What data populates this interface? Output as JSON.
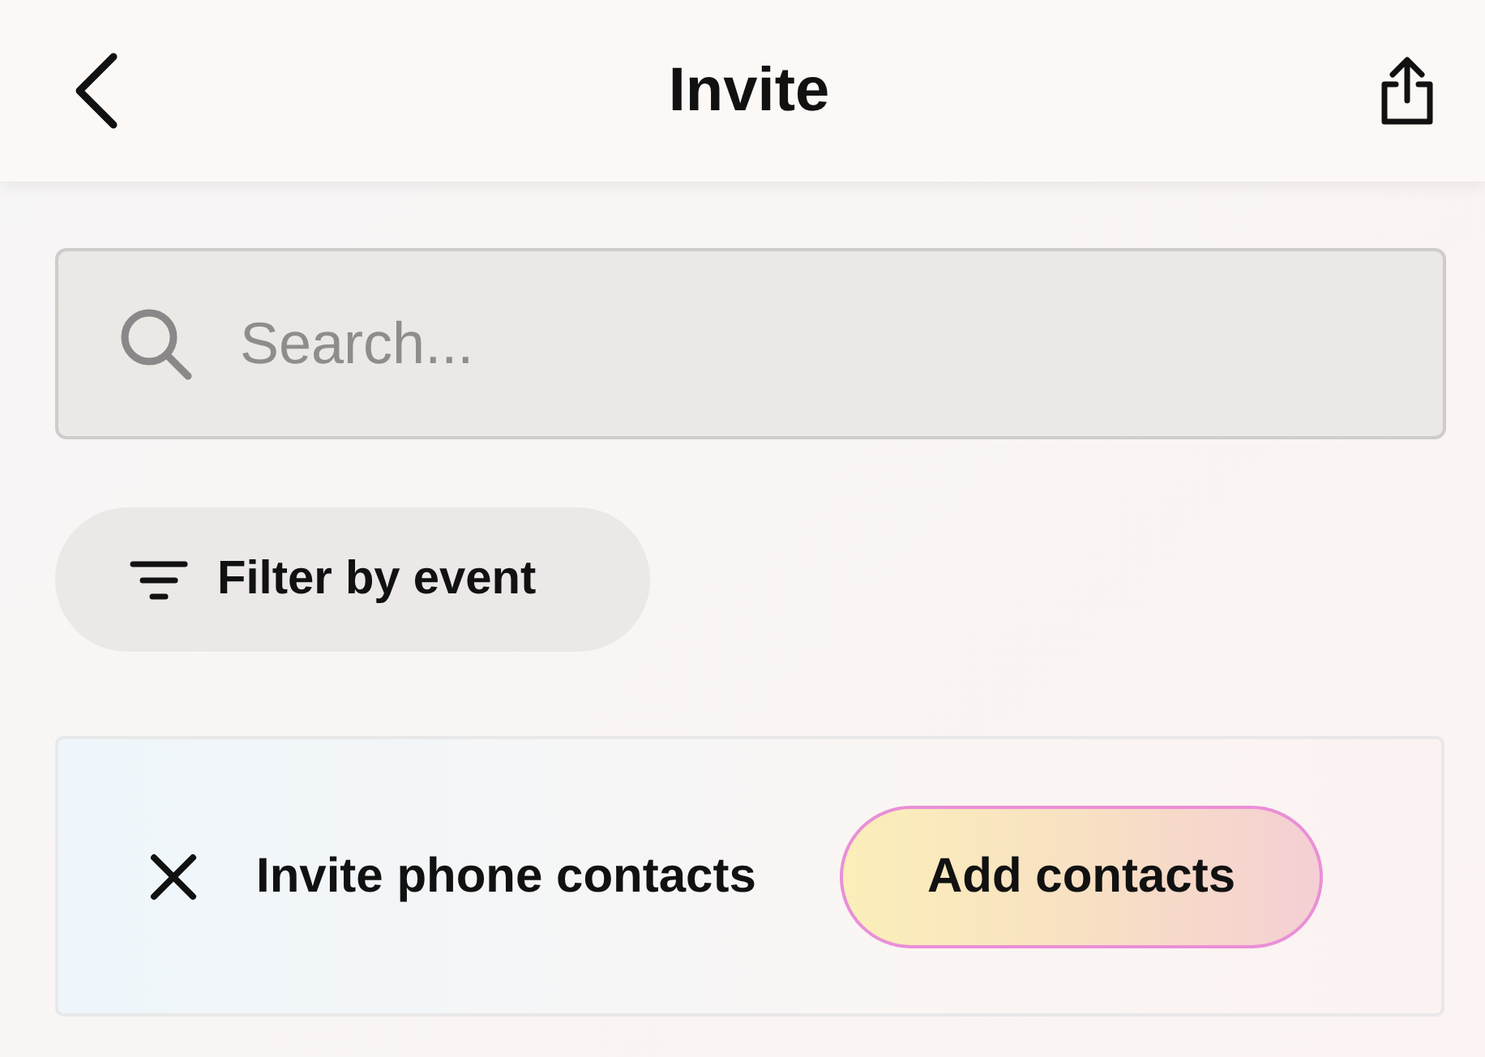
{
  "header": {
    "title": "Invite"
  },
  "search": {
    "placeholder": "Search..."
  },
  "filter_button": {
    "label": "Filter by event"
  },
  "contacts_banner": {
    "text": "Invite phone contacts",
    "button": "Add contacts"
  }
}
